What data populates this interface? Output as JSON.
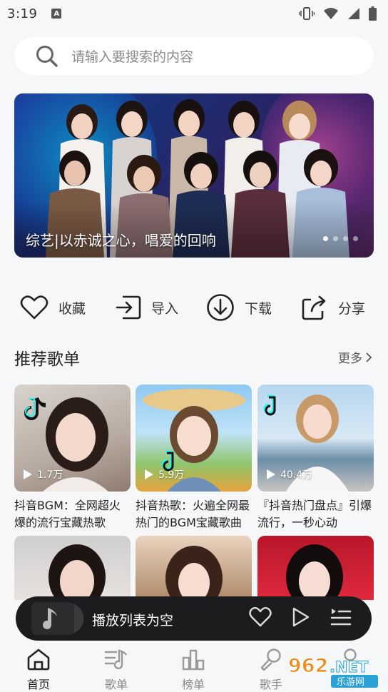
{
  "status_bar": {
    "time": "3:19",
    "notify_glyph": "A"
  },
  "search": {
    "placeholder": "请输入要搜索的内容"
  },
  "banner": {
    "caption": "综艺|以赤诚之心，唱爱的回响",
    "page_count": 4,
    "active_page": 1
  },
  "actions": [
    {
      "label": "收藏",
      "icon": "heart-icon"
    },
    {
      "label": "导入",
      "icon": "import-icon"
    },
    {
      "label": "下载",
      "icon": "download-icon"
    },
    {
      "label": "分享",
      "icon": "share-icon"
    }
  ],
  "playlists": {
    "title": "推荐歌单",
    "more_label": "更多",
    "items": [
      {
        "plays": "1.7万",
        "title": "抖音BGM：全网超火爆的流行宝藏热歌"
      },
      {
        "plays": "5.9万",
        "title": "抖音热歌：火遍全网最热门的BGM宝藏歌曲"
      },
      {
        "plays": "40.4万",
        "title": "『抖音热门盘点』引爆流行，一秒心动"
      }
    ]
  },
  "player": {
    "status_text": "播放列表为空"
  },
  "tabs": [
    {
      "label": "首页",
      "icon": "home-icon",
      "active": true
    },
    {
      "label": "歌单",
      "icon": "playlist-icon",
      "active": false
    },
    {
      "label": "榜单",
      "icon": "chart-icon",
      "active": false
    },
    {
      "label": "歌手",
      "icon": "singer-icon",
      "active": false
    }
  ],
  "watermark": {
    "brand": "962.NET",
    "sub": "乐游网"
  },
  "colors": {
    "background": "#f6f7f9",
    "player": "#1c1c1e",
    "text": "#222222",
    "muted": "#888888"
  }
}
